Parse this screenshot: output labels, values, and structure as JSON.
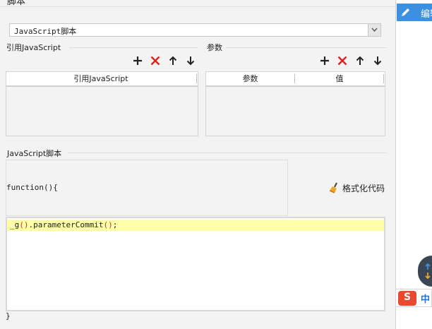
{
  "window": {
    "title_fragment": "脚本"
  },
  "script_type_select": {
    "value": "JavaScript脚本"
  },
  "ref_js": {
    "section_label": "引用JavaScript",
    "column_header": "引用JavaScript"
  },
  "params": {
    "section_label": "参数",
    "columns": [
      "参数",
      "值"
    ]
  },
  "js_script": {
    "section_label": "JavaScript脚本",
    "function_header": "function(){",
    "format_button_label": "格式化代码",
    "code_ident": "_g",
    "code_open": "(",
    "code_close": ")",
    "code_method": ".parameterCommit",
    "code_open2": "(",
    "code_close2": ")",
    "code_end": ";",
    "closing_brace": "}"
  },
  "right_panel": {
    "edit_tab_label": "编辑"
  },
  "ime": {
    "logo": "S",
    "mode": "中"
  },
  "colors": {
    "accent": "#3d8fe0",
    "add": "#222222",
    "delete": "#e02020",
    "highlight": "#ffffa8"
  },
  "icons": {
    "toolbar": [
      "plus-icon",
      "delete-icon",
      "arrow-up-icon",
      "arrow-down-icon"
    ],
    "edit_tab": "pencil-icon",
    "format": "broom-icon"
  }
}
